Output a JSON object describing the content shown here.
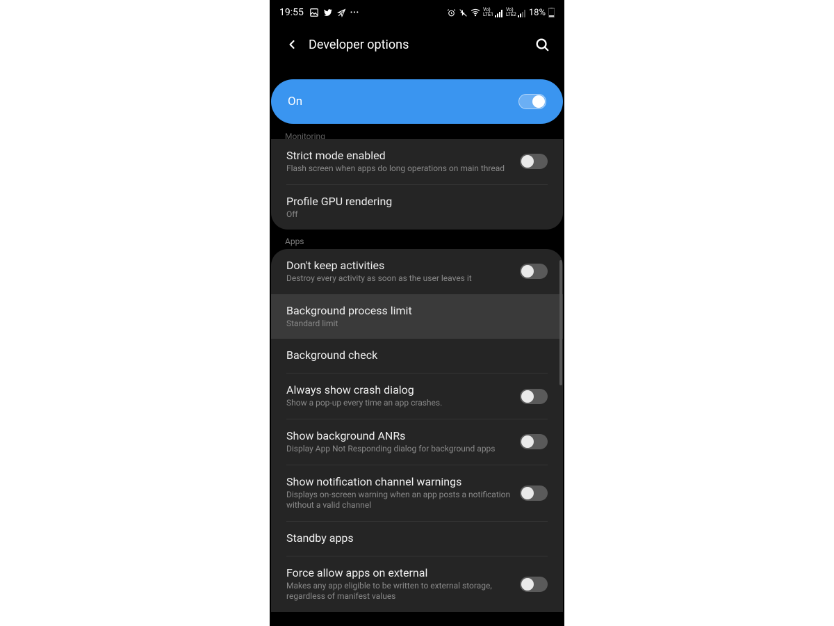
{
  "status": {
    "time": "19:55",
    "battery": "18%",
    "icons_left": [
      "gallery",
      "twitter",
      "phone-off",
      "more"
    ],
    "icons_right": [
      "alarm",
      "vibrate",
      "wifi",
      "signal-lte1",
      "signal-lte2",
      "battery"
    ]
  },
  "header": {
    "title": "Developer options"
  },
  "master": {
    "label": "On",
    "state": "on"
  },
  "sections": [
    {
      "id": "monitoring",
      "header": "Monitoring",
      "cut_top": true,
      "items": [
        {
          "id": "strict-mode",
          "title": "Strict mode enabled",
          "sub": "Flash screen when apps do long operations on main thread",
          "toggle": "off"
        },
        {
          "id": "profile-gpu",
          "title": "Profile GPU rendering",
          "sub": "Off"
        }
      ]
    },
    {
      "id": "apps",
      "header": "Apps",
      "items": [
        {
          "id": "dont-keep-activities",
          "title": "Don't keep activities",
          "sub": "Destroy every activity as soon as the user leaves it",
          "toggle": "off"
        },
        {
          "id": "bg-process-limit",
          "title": "Background process limit",
          "sub": "Standard limit",
          "selected": true
        },
        {
          "id": "bg-check",
          "title": "Background check"
        },
        {
          "id": "crash-dialog",
          "title": "Always show crash dialog",
          "sub": "Show a pop-up every time an app crashes.",
          "toggle": "off"
        },
        {
          "id": "bg-anrs",
          "title": "Show background ANRs",
          "sub": "Display App Not Responding dialog for background apps",
          "toggle": "off"
        },
        {
          "id": "notif-warn",
          "title": "Show notification channel warnings",
          "sub": "Displays on-screen warning when an app posts a notification without a valid channel",
          "toggle": "off"
        },
        {
          "id": "standby-apps",
          "title": "Standby apps"
        },
        {
          "id": "force-external",
          "title": "Force allow apps on external",
          "sub": "Makes any app eligible to be written to external storage, regardless of manifest values",
          "toggle": "off"
        }
      ]
    }
  ]
}
